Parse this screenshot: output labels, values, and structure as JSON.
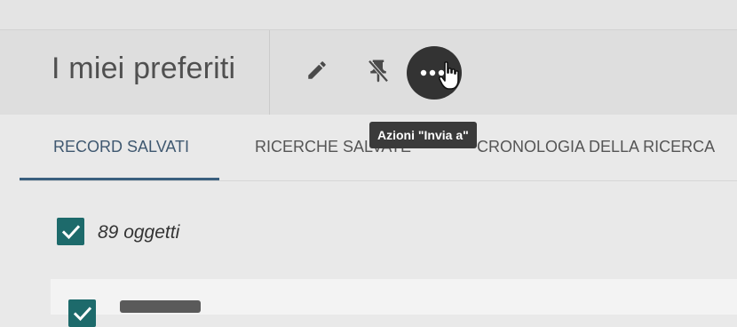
{
  "header": {
    "title": "I miei preferiti",
    "actions": {
      "edit_icon": "pencil-icon",
      "unpin_icon": "unpin-icon",
      "more_icon": "ellipsis-icon",
      "more_tooltip": "Azioni \"Invia a\""
    }
  },
  "tabs": [
    {
      "label": "RECORD SALVATI",
      "active": true
    },
    {
      "label": "RICERCHE SALVATE",
      "active": false
    },
    {
      "label": "CRONOLOGIA DELLA RICERCA",
      "active": false
    }
  ],
  "selection": {
    "count_label": "89 oggetti",
    "all_selected": true
  },
  "colors": {
    "accent": "#3a5f7e",
    "checkbox": "#1d6a6b",
    "tooltip_bg": "#3a3a3a",
    "more_button_bg": "#333333"
  }
}
